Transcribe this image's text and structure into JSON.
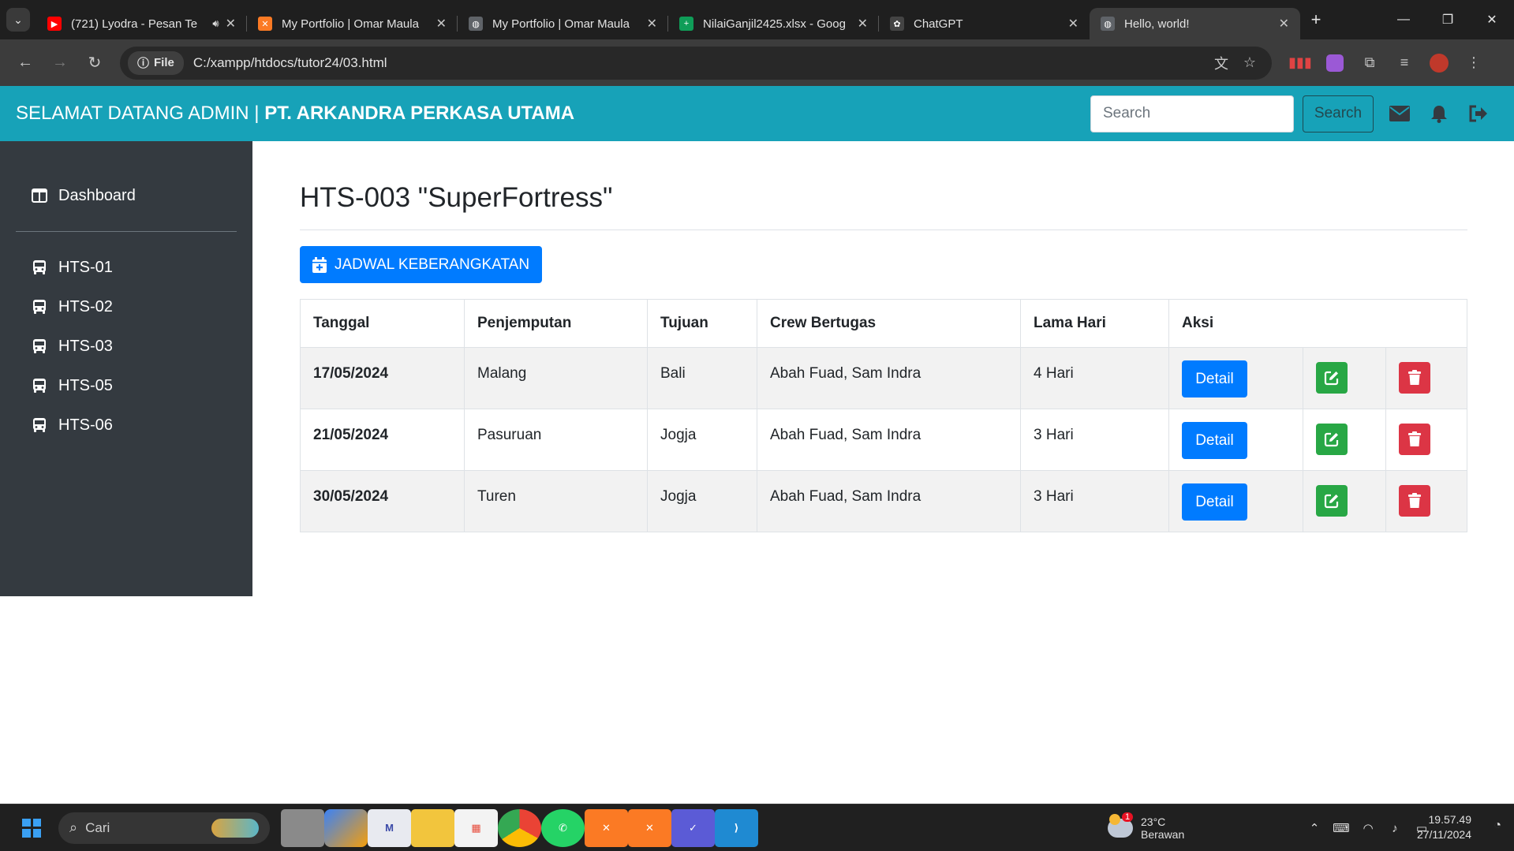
{
  "browser": {
    "tabs": [
      {
        "title": "(721) Lyodra - Pesan Te",
        "icon": "youtube-icon",
        "color": "#ff0000",
        "glyph": "▶"
      },
      {
        "title": "My Portfolio | Omar Maula",
        "icon": "xampp-icon",
        "color": "#fb7a24",
        "glyph": "✕"
      },
      {
        "title": "My Portfolio | Omar Maula",
        "icon": "globe-icon",
        "color": "#5f6368",
        "glyph": "◍"
      },
      {
        "title": "NilaiGanjil2425.xlsx - Goog",
        "icon": "sheets-icon",
        "color": "#0f9d58",
        "glyph": "+"
      },
      {
        "title": "ChatGPT",
        "icon": "chatgpt-icon",
        "color": "#444444",
        "glyph": "✿"
      },
      {
        "title": "Hello, world!",
        "icon": "globe-icon",
        "color": "#5f6368",
        "glyph": "◍"
      }
    ],
    "file_chip": "File",
    "url": "C:/xampp/htdocs/tutor24/03.html"
  },
  "navbar": {
    "welcome": "SELAMAT DATANG ADMIN |",
    "company": "PT. ARKANDRA PERKASA UTAMA",
    "search_placeholder": "Search",
    "search_button": "Search"
  },
  "sidebar": {
    "dashboard": "Dashboard",
    "items": [
      "HTS-01",
      "HTS-02",
      "HTS-03",
      "HTS-05",
      "HTS-06"
    ]
  },
  "main": {
    "title": "HTS-003 \"SuperFortress\"",
    "schedule_button": "JADWAL KEBERANGKATAN",
    "table": {
      "headers": [
        "Tanggal",
        "Penjemputan",
        "Tujuan",
        "Crew Bertugas",
        "Lama Hari",
        "Aksi"
      ],
      "detail_label": "Detail",
      "rows": [
        {
          "tanggal": "17/05/2024",
          "penjemputan": "Malang",
          "tujuan": "Bali",
          "crew": "Abah Fuad, Sam Indra",
          "lama": "4 Hari"
        },
        {
          "tanggal": "21/05/2024",
          "penjemputan": "Pasuruan",
          "tujuan": "Jogja",
          "crew": "Abah Fuad, Sam Indra",
          "lama": "3 Hari"
        },
        {
          "tanggal": "30/05/2024",
          "penjemputan": "Turen",
          "tujuan": "Jogja",
          "crew": "Abah Fuad, Sam Indra",
          "lama": "3 Hari"
        }
      ]
    }
  },
  "taskbar": {
    "search_placeholder": "Cari",
    "weather_temp": "23°C",
    "weather_desc": "Berawan",
    "weather_badge": "1",
    "time": "19.57.49",
    "date": "27/11/2024"
  },
  "colors": {
    "navbar": "#17a2b8",
    "sidebar": "#343a40",
    "primary": "#007bff",
    "success": "#28a745",
    "danger": "#dc3545"
  }
}
